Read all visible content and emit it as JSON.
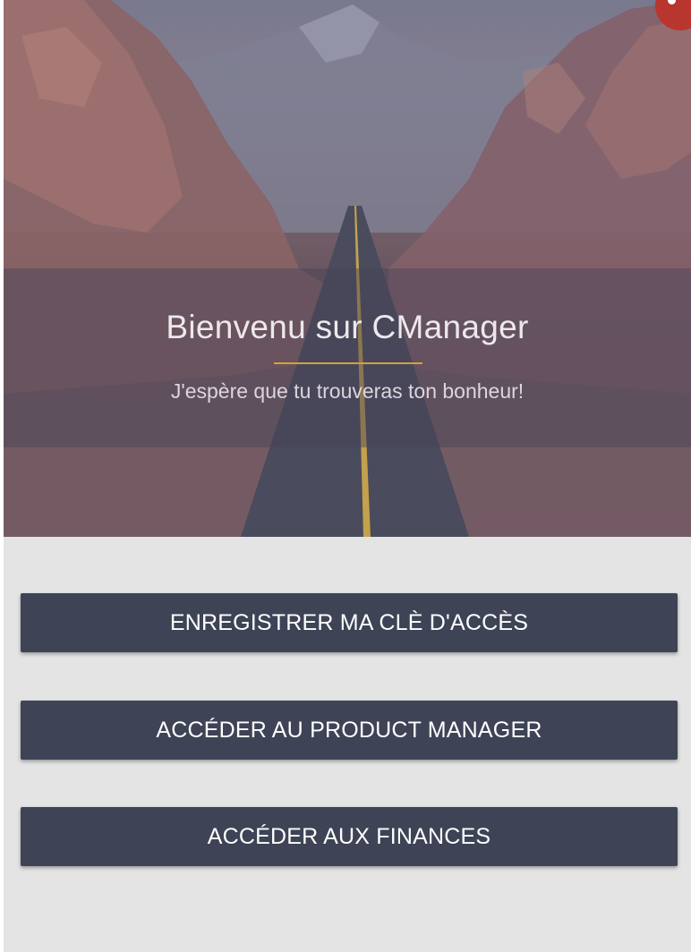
{
  "hero": {
    "title": "Bienvenu sur CManager",
    "subtitle": "J'espère que tu trouveras ton bonheur!",
    "accent_color": "#d4a13a"
  },
  "actions": {
    "register_key_label": "ENREGISTRER MA CLÈ D'ACCÈS",
    "product_manager_label": "ACCÉDER AU PRODUCT MANAGER",
    "finances_label": "ACCÉDER AUX FINANCES"
  },
  "colors": {
    "button_bg": "#3e4356",
    "panel_bg": "#e4e4e4",
    "close_badge": "#b8362e"
  },
  "icons": {
    "close": "close-icon"
  }
}
